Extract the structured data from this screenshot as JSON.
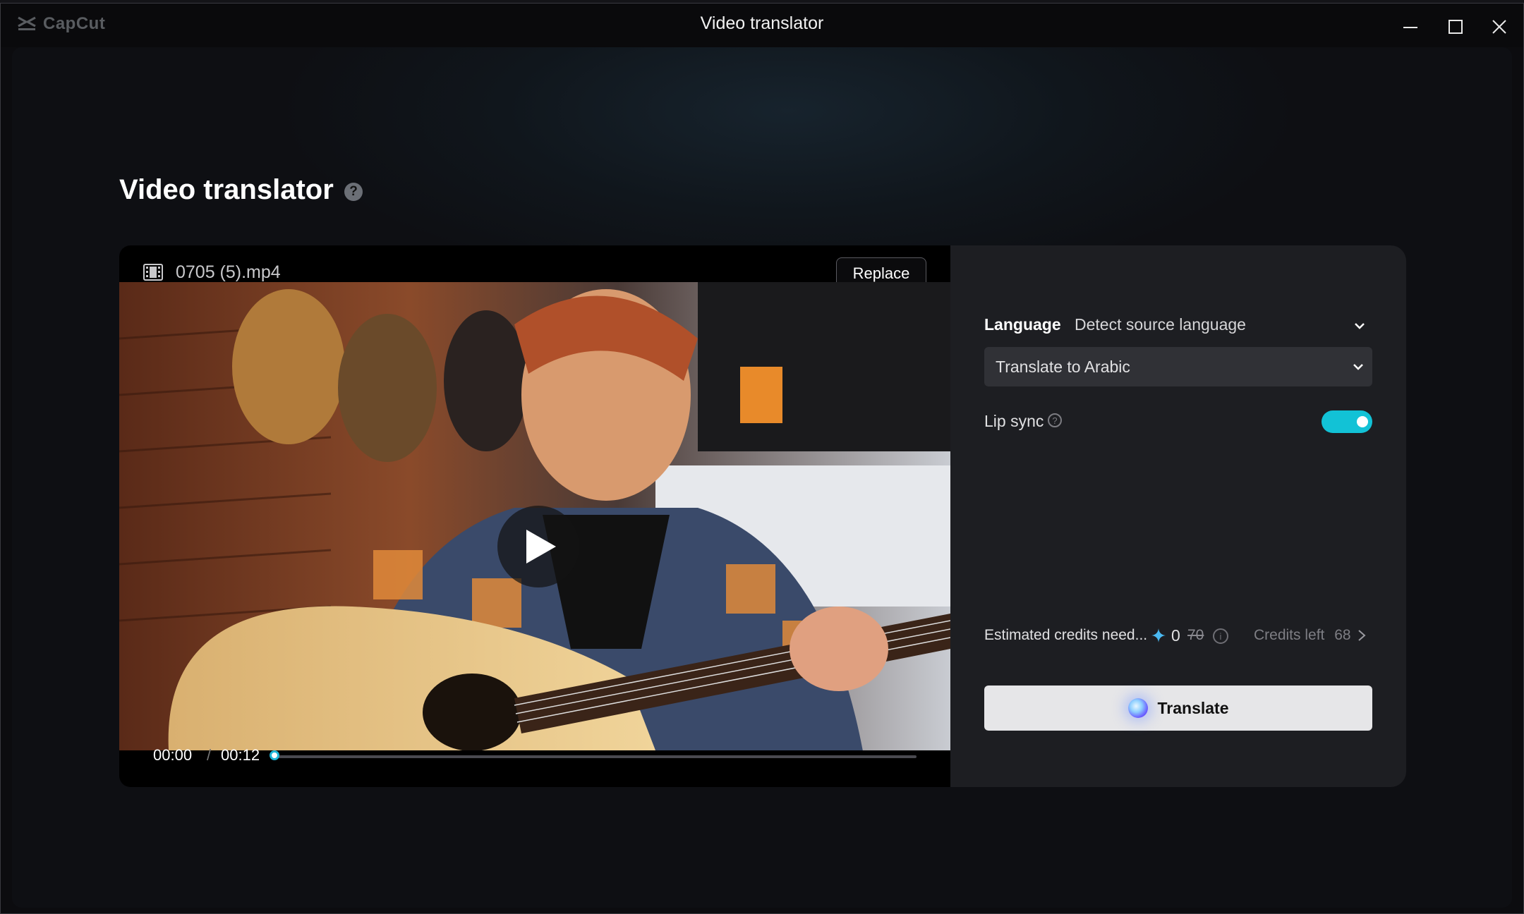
{
  "app": {
    "logo_text": "CapCut",
    "window_title": "Video translator"
  },
  "page": {
    "title": "Video translator"
  },
  "video": {
    "file_name": "0705 (5).mp4",
    "replace_label": "Replace",
    "current_time": "00:00",
    "separator": "/",
    "total_time": "00:12",
    "progress": 0
  },
  "settings": {
    "language_label": "Language",
    "source_language": "Detect source language",
    "target_language": "Translate to Arabic",
    "lip_sync_label": "Lip sync",
    "lip_sync_enabled": true,
    "estimated_credits_label": "Estimated credits need...",
    "credits_needed": "0",
    "credits_original": "70",
    "credits_left_label": "Credits left",
    "credits_left": "68",
    "translate_label": "Translate"
  },
  "colors": {
    "accent": "#12c2d6",
    "panel": "#1d1e22",
    "button": "#e6e6e8"
  }
}
